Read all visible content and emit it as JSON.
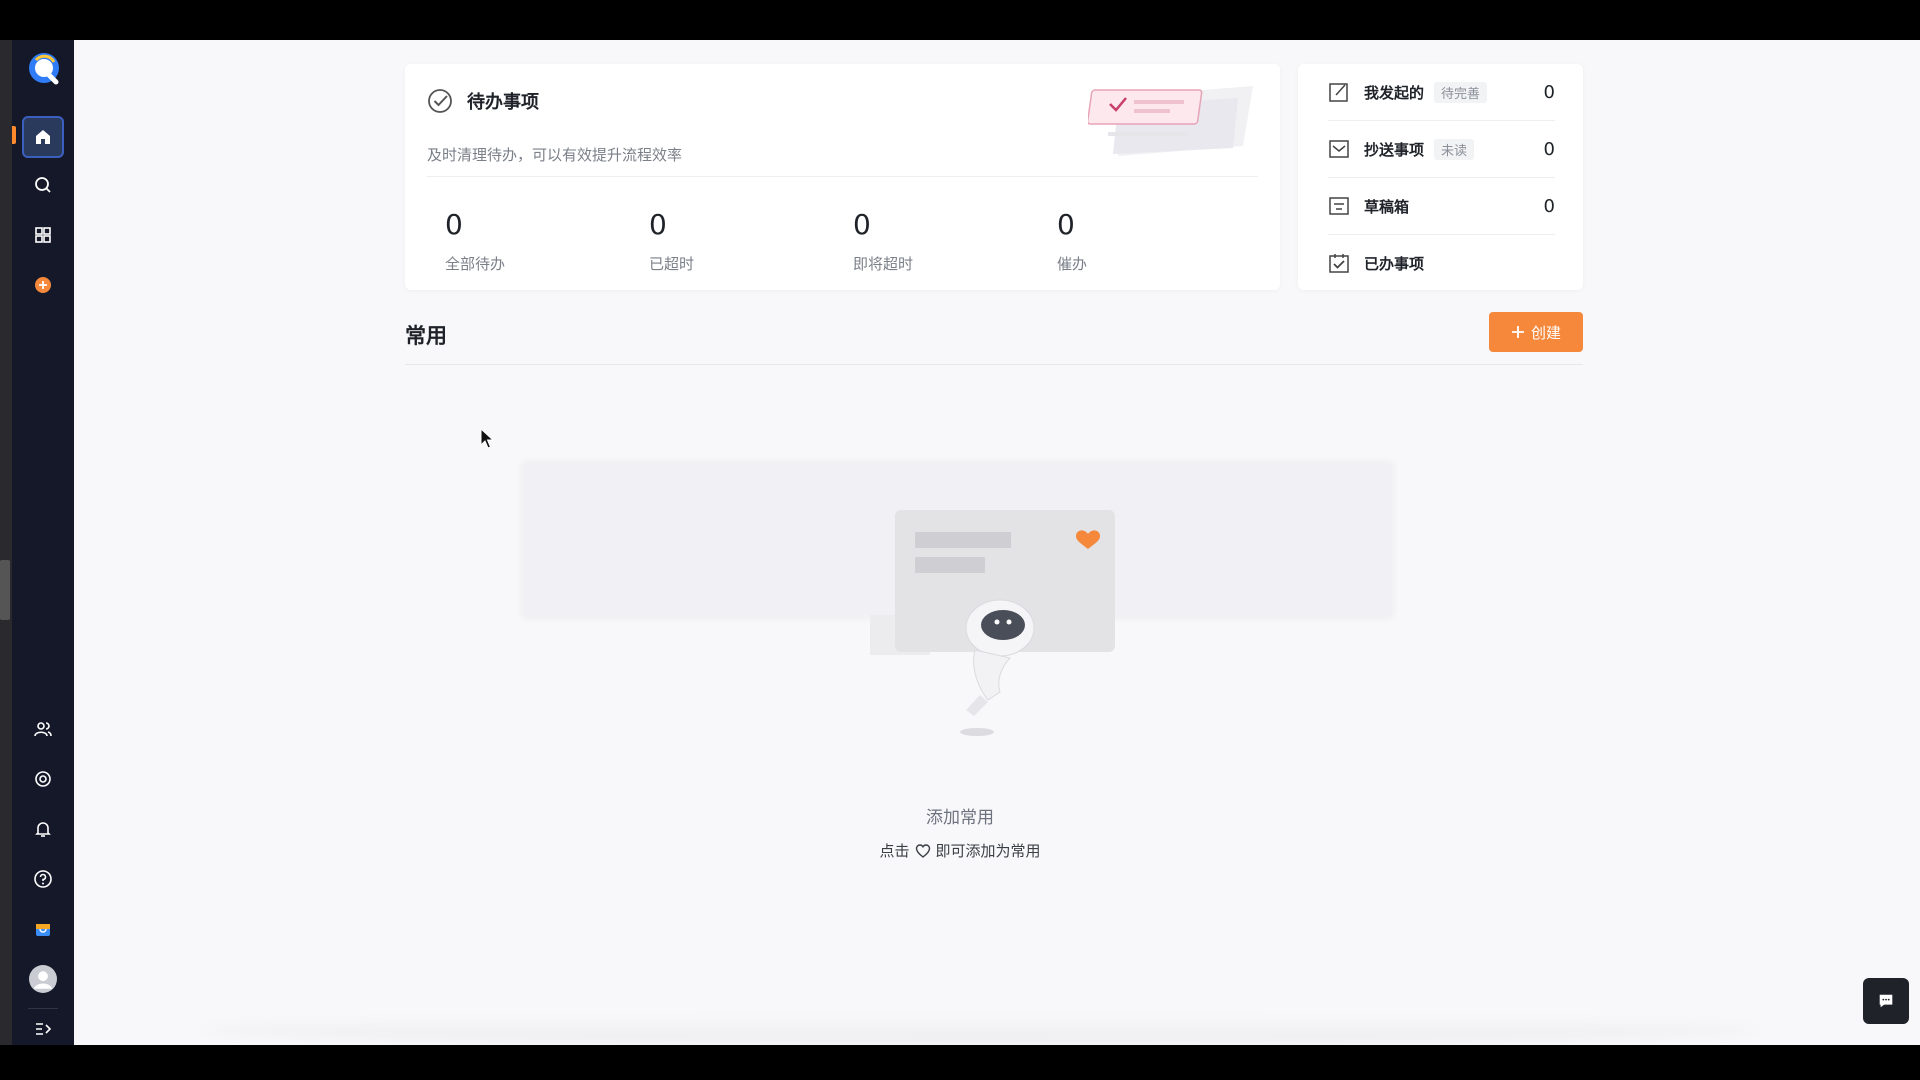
{
  "todo": {
    "title": "待办事项",
    "subtitle": "及时清理待办，可以有效提升流程效率",
    "stats": [
      {
        "value": "0",
        "label": "全部待办"
      },
      {
        "value": "0",
        "label": "已超时"
      },
      {
        "value": "0",
        "label": "即将超时"
      },
      {
        "value": "0",
        "label": "催办"
      }
    ]
  },
  "side": {
    "items": [
      {
        "label": "我发起的",
        "badge": "待完善",
        "count": "0",
        "icon": "edit-icon"
      },
      {
        "label": "抄送事项",
        "badge": "未读",
        "count": "0",
        "icon": "mail-icon"
      },
      {
        "label": "草稿箱",
        "badge": "",
        "count": "0",
        "icon": "draft-icon"
      },
      {
        "label": "已办事项",
        "badge": "",
        "count": "",
        "icon": "calendar-check-icon"
      }
    ]
  },
  "common": {
    "title": "常用",
    "create_label": "创建",
    "empty_title": "添加常用",
    "empty_hint_prefix": "点击",
    "empty_hint_suffix": "即可添加为常用"
  },
  "colors": {
    "accent": "#f5883a",
    "sidebar_bg": "#141828",
    "active_blue": "#3b5fbf"
  }
}
